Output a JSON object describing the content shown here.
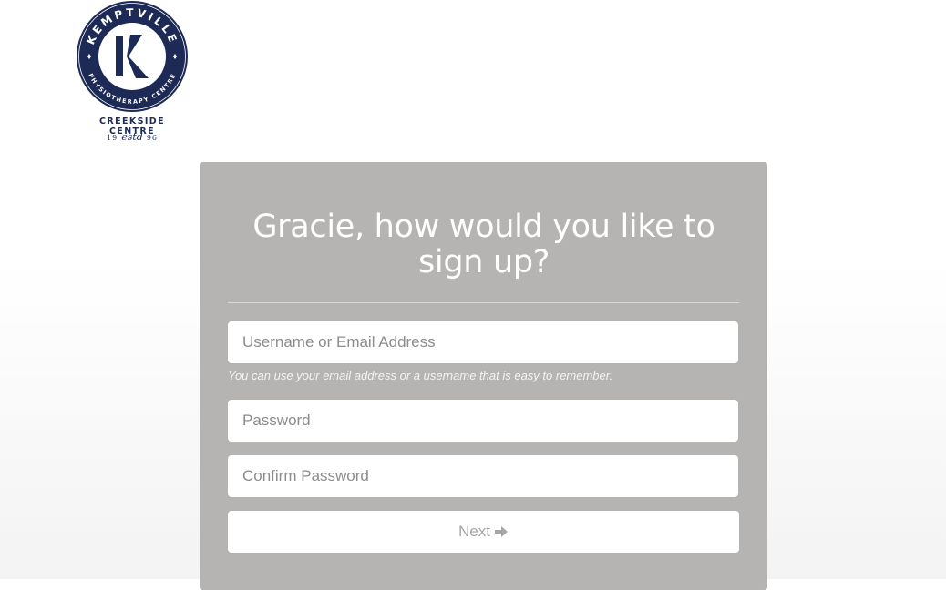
{
  "logo": {
    "arc_top": "KEMPTVILLE",
    "arc_bottom": "PHYSIOTHERAPY CENTRE",
    "subtitle": "CREEKSIDE CENTRE",
    "est_left": "19",
    "est_mid": "estd",
    "est_right": "96",
    "brand_color": "#1d2a55"
  },
  "signup": {
    "title": "Gracie, how would you like to sign up?",
    "username_placeholder": "Username or Email Address",
    "username_hint": "You can use your email address or a username that is easy to remember.",
    "password_placeholder": "Password",
    "confirm_placeholder": "Confirm Password",
    "next_label": "Next",
    "next_icon": "arrow-right-icon",
    "card_color": "#b5b4b2"
  }
}
